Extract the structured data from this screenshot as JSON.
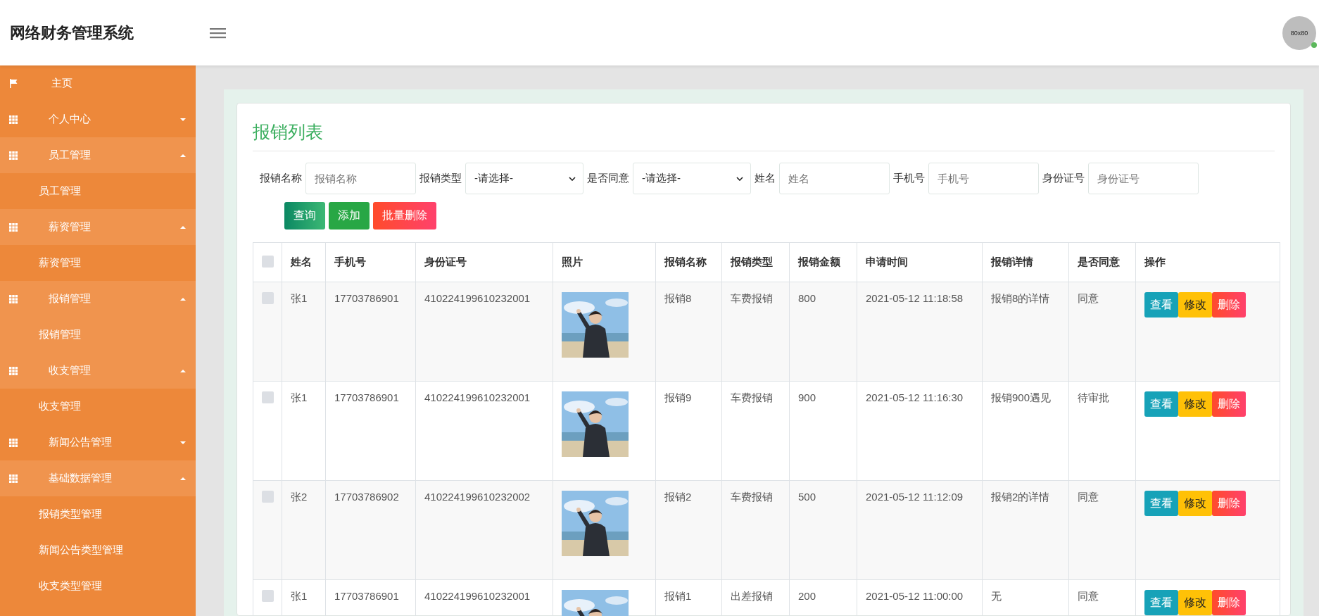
{
  "header": {
    "title": "网络财务管理系统",
    "avatar": "80x80"
  },
  "sidebar": {
    "items": [
      {
        "kind": "link",
        "label": "主页"
      },
      {
        "kind": "group",
        "label": "个人中心",
        "expanded": false
      },
      {
        "kind": "group",
        "label": "员工管理",
        "expanded": true,
        "children": [
          {
            "label": "员工管理",
            "selected": false
          }
        ]
      },
      {
        "kind": "group",
        "label": "薪资管理",
        "expanded": true,
        "children": [
          {
            "label": "薪资管理",
            "selected": false
          }
        ]
      },
      {
        "kind": "group",
        "label": "报销管理",
        "expanded": true,
        "children": [
          {
            "label": "报销管理",
            "selected": true
          }
        ]
      },
      {
        "kind": "group",
        "label": "收支管理",
        "expanded": true,
        "children": [
          {
            "label": "收支管理",
            "selected": false
          }
        ]
      },
      {
        "kind": "group",
        "label": "新闻公告管理",
        "expanded": false
      },
      {
        "kind": "group",
        "label": "基础数据管理",
        "expanded": true,
        "children": [
          {
            "label": "报销类型管理",
            "selected": false
          },
          {
            "label": "新闻公告类型管理",
            "selected": false
          },
          {
            "label": "收支类型管理",
            "selected": false
          }
        ]
      }
    ]
  },
  "content": {
    "title": "报销列表",
    "filters": [
      {
        "kind": "input",
        "label": "报销名称",
        "placeholder": "报销名称"
      },
      {
        "kind": "select",
        "label": "报销类型",
        "value": "-请选择-"
      },
      {
        "kind": "select",
        "label": "是否同意",
        "value": "-请选择-"
      },
      {
        "kind": "input",
        "label": "姓名",
        "placeholder": "姓名"
      },
      {
        "kind": "input",
        "label": "手机号",
        "placeholder": "手机号"
      },
      {
        "kind": "input",
        "label": "身份证号",
        "placeholder": "身份证号"
      }
    ],
    "buttons": [
      {
        "kind": "search",
        "label": "查询"
      },
      {
        "kind": "add",
        "label": "添加"
      },
      {
        "kind": "delete",
        "label": "批量删除"
      }
    ],
    "table": {
      "header_checked": false,
      "columns": [
        "姓名",
        "手机号",
        "身份证号",
        "照片",
        "报销名称",
        "报销类型",
        "报销金额",
        "申请时间",
        "报销详情",
        "是否同意",
        "操作"
      ],
      "rows": [
        {
          "checked": false,
          "name": "张1",
          "phone": "17703786901",
          "id_number": "410224199610232001",
          "photo": {
            "kind": "picture"
          },
          "title": "报销8",
          "type": "车费报销",
          "amount": "800",
          "time": "2021-05-12 11:18:58",
          "detail": "报销8的详情",
          "agree": "同意",
          "actions": [
            {
              "kind": "view",
              "label": "查看"
            },
            {
              "kind": "edit",
              "label": "修改"
            },
            {
              "kind": "delete",
              "label": "删除"
            }
          ]
        },
        {
          "checked": false,
          "name": "张1",
          "phone": "17703786901",
          "id_number": "410224199610232001",
          "photo": {
            "kind": "picture"
          },
          "title": "报销9",
          "type": "车费报销",
          "amount": "900",
          "time": "2021-05-12 11:16:30",
          "detail": "报销900遇见",
          "agree": "待审批",
          "actions": [
            {
              "kind": "view",
              "label": "查看"
            },
            {
              "kind": "edit",
              "label": "修改"
            },
            {
              "kind": "delete",
              "label": "删除"
            }
          ]
        },
        {
          "checked": false,
          "name": "张2",
          "phone": "17703786902",
          "id_number": "410224199610232002",
          "photo": {
            "kind": "picture"
          },
          "title": "报销2",
          "type": "车费报销",
          "amount": "500",
          "time": "2021-05-12 11:12:09",
          "detail": "报销2的详情",
          "agree": "同意",
          "actions": [
            {
              "kind": "view",
              "label": "查看"
            },
            {
              "kind": "edit",
              "label": "修改"
            },
            {
              "kind": "delete",
              "label": "删除"
            }
          ]
        },
        {
          "checked": false,
          "name": "张1",
          "phone": "17703786901",
          "id_number": "410224199610232001",
          "photo": {
            "kind": "picture"
          },
          "title": "报销1",
          "type": "出差报销",
          "amount": "200",
          "time": "2021-05-12 11:00:00",
          "detail": "无",
          "agree": "同意",
          "actions": [
            {
              "kind": "view",
              "label": "查看"
            },
            {
              "kind": "edit",
              "label": "修改"
            },
            {
              "kind": "delete",
              "label": "删除"
            }
          ]
        }
      ]
    }
  }
}
